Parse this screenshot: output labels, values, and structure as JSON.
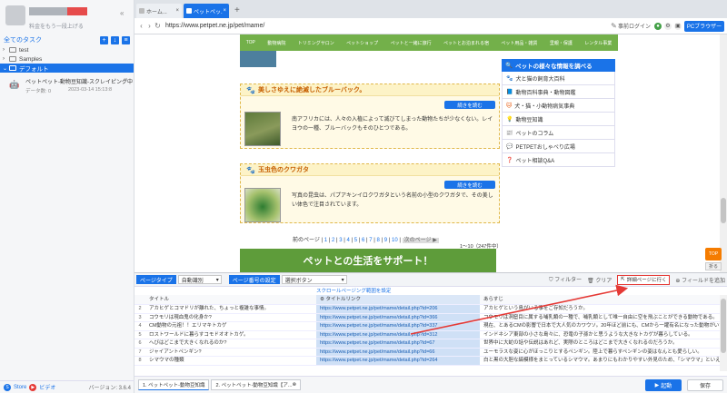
{
  "sidebar": {
    "upgrade_label": "料金をもう一段上げる",
    "all_tasks_label": "全てのタスク",
    "tree": [
      {
        "label": "test",
        "selected": false
      },
      {
        "label": "Samples",
        "selected": false
      },
      {
        "label": "デフォルト",
        "selected": true
      }
    ],
    "task": {
      "title": "ペットペット-動物豆知識-スクレイピング中",
      "data_label": "データ数: 0",
      "time": "2023-03-14 15:13:8"
    },
    "footer": {
      "link1": "Store",
      "link2": "ビデオ",
      "version": "バージョン: 3.6.4"
    }
  },
  "browser": {
    "tabs": [
      {
        "label": "ホーム...",
        "active": false
      },
      {
        "label": "ペットペッ...",
        "active": true
      }
    ],
    "url": "https://www.petpet.ne.jp/pet/mame/",
    "login_label": "事前ログイン",
    "pc_browser_label": "PCブラウザー"
  },
  "website": {
    "nav": [
      "TOP",
      "動物病院",
      "トリミングサロン",
      "ペットショップ",
      "ペットと一緒に旅行",
      "ペットとお泊まれる宿",
      "ペット用品・雑貨",
      "里親・保護",
      "レンタル事業"
    ],
    "cards": [
      {
        "title": "美しさゆえに絶滅したブルーバック。",
        "read_more": "続きを読む",
        "desc": "南アフリカには、人々の入植によって滅びてしまった動物たちが少なくない。レイヨウの一種、ブルーバックもそのひとつである。"
      },
      {
        "title": "玉虫色のクワガタ",
        "read_more": "続きを読む",
        "desc": "写真の昆虫は、パプアキンイロクワガタという名前の小型のクワガタで、その美しい体色で注目されています。"
      }
    ],
    "right_panel": {
      "header": "ペットの様々な情報を調べる",
      "items": [
        "犬と猫の飼育大百科",
        "動物百科事典・動物図鑑",
        "犬・猫・小動物病気事典",
        "動物豆知識",
        "ペットのコラム",
        "PETPETおしゃべり広場",
        "ペット相談Q&A"
      ]
    },
    "pagination": {
      "prev": "前のページ",
      "pages": [
        "1",
        "2",
        "3",
        "4",
        "5",
        "6",
        "7",
        "8",
        "9",
        "10"
      ],
      "next": "次のページ ▶",
      "count": "1〜10（247件中）"
    },
    "banner": "ペットとの生活をサポート！",
    "float_top": "TOP",
    "float_fold": "折る"
  },
  "data_panel": {
    "page_type_label": "ページタイプ",
    "page_type_value": "自動識別",
    "page_nav_label": "ページ番号の設定",
    "page_nav_value": "選択ボタン",
    "scroll_hint": "スクロールページング範囲を設定",
    "filter_label": "フィルター",
    "clear_label": "クリア",
    "detail_button": "詳細ページに行く",
    "add_field": "フィールドを追加",
    "columns": [
      "タイトル",
      "タイトルリンク",
      "あらすじ"
    ],
    "rows": [
      {
        "n": "2",
        "title": "アカヒゲとコマドリが離れた、ちょっと複雑な事情。",
        "link": "https://www.petpet.ne.jp/pet/mame/detail.php?id=206",
        "summary": "アカヒゲという鳥がいる事をご存知だろうか。"
      },
      {
        "n": "3",
        "title": "コウモリは現血鬼の化身か?",
        "link": "https://www.petpet.ne.jp/pet/mame/detail.php?id=366",
        "summary": "コウモリは洞窟目に属する哺乳類の一種で、哺乳類として唯一自由に空を飛ぶことができる動物である。"
      },
      {
        "n": "4",
        "title": "CM動物の元祖！！エリマキトカゲ",
        "link": "https://www.petpet.ne.jp/pet/mame/detail.php?id=337",
        "summary": "現在、とあるCMの影響で日本で大人気のカワウソ。20年ほど前にも、CMから一躍有名になった動物がいた。"
      },
      {
        "n": "5",
        "title": "ロストワールドに暮らすコモドオオトカゲ。",
        "link": "https://www.petpet.ne.jp/pet/mame/detail.php?id=312",
        "summary": "インドネシア東部の小さな島々に、恐竜の子孫かと思うような大きなトカゲが暮らしている。"
      },
      {
        "n": "6",
        "title": "へびはどこまで大きくなれるのか?",
        "link": "https://www.petpet.ne.jp/pet/mame/detail.php?id=67",
        "summary": "世界中に大蛇の話や伝説はあれど、実際のところはどこまで大きくなれるのだろうか。"
      },
      {
        "n": "7",
        "title": "ジャイアントペンギン?",
        "link": "https://www.petpet.ne.jp/pet/mame/detail.php?id=66",
        "summary": "ユーモラスな姿に心がほっこりとするペンギン。陸上で暮らすペンギンの姿はなんとも愛らしい。"
      },
      {
        "n": "8",
        "title": "シマウマの種類",
        "link": "https://www.petpet.ne.jp/pet/mame/detail.php?id=264",
        "summary": "白と黒の大胆な縞模様をまとっているシマウマ。あまりにもわかりやすい外見のため、「シマウマ」といえば一種類と思われがち。"
      }
    ],
    "bottom_tabs": [
      "1. ペットペット-動物豆知識",
      "2. ペットペット-動物豆知識【ア..."
    ],
    "run_button": "起動",
    "save_button": "保存"
  }
}
